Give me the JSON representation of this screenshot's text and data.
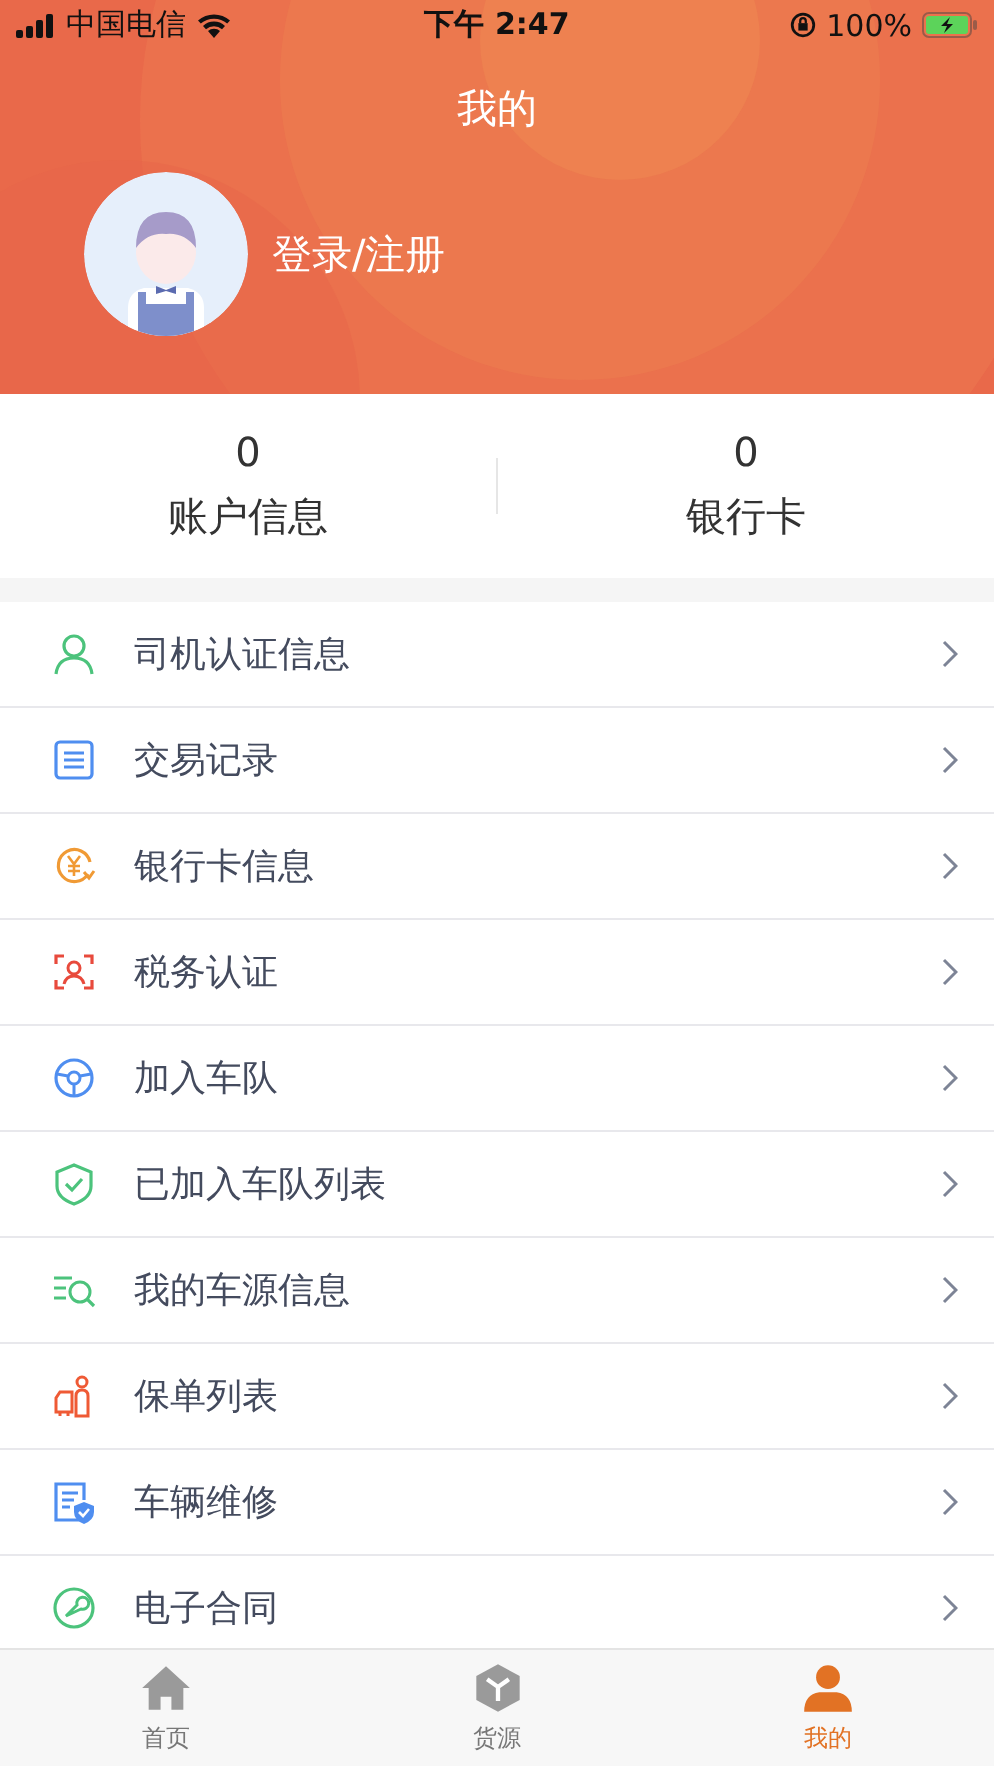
{
  "status_bar": {
    "carrier": "中国电信",
    "time": "下午 2:47",
    "battery": "100%"
  },
  "header": {
    "title": "我的",
    "login": "登录/注册"
  },
  "stats": [
    {
      "value": "0",
      "label": "账户信息"
    },
    {
      "value": "0",
      "label": "银行卡"
    }
  ],
  "menu": [
    {
      "label": "司机认证信息"
    },
    {
      "label": "交易记录"
    },
    {
      "label": "银行卡信息"
    },
    {
      "label": "税务认证"
    },
    {
      "label": "加入车队"
    },
    {
      "label": "已加入车队列表"
    },
    {
      "label": "我的车源信息"
    },
    {
      "label": "保单列表"
    },
    {
      "label": "车辆维修"
    },
    {
      "label": "电子合同"
    }
  ],
  "tab_bar": [
    {
      "label": "首页",
      "selected": false
    },
    {
      "label": "货源",
      "selected": false
    },
    {
      "label": "我的",
      "selected": true
    }
  ]
}
